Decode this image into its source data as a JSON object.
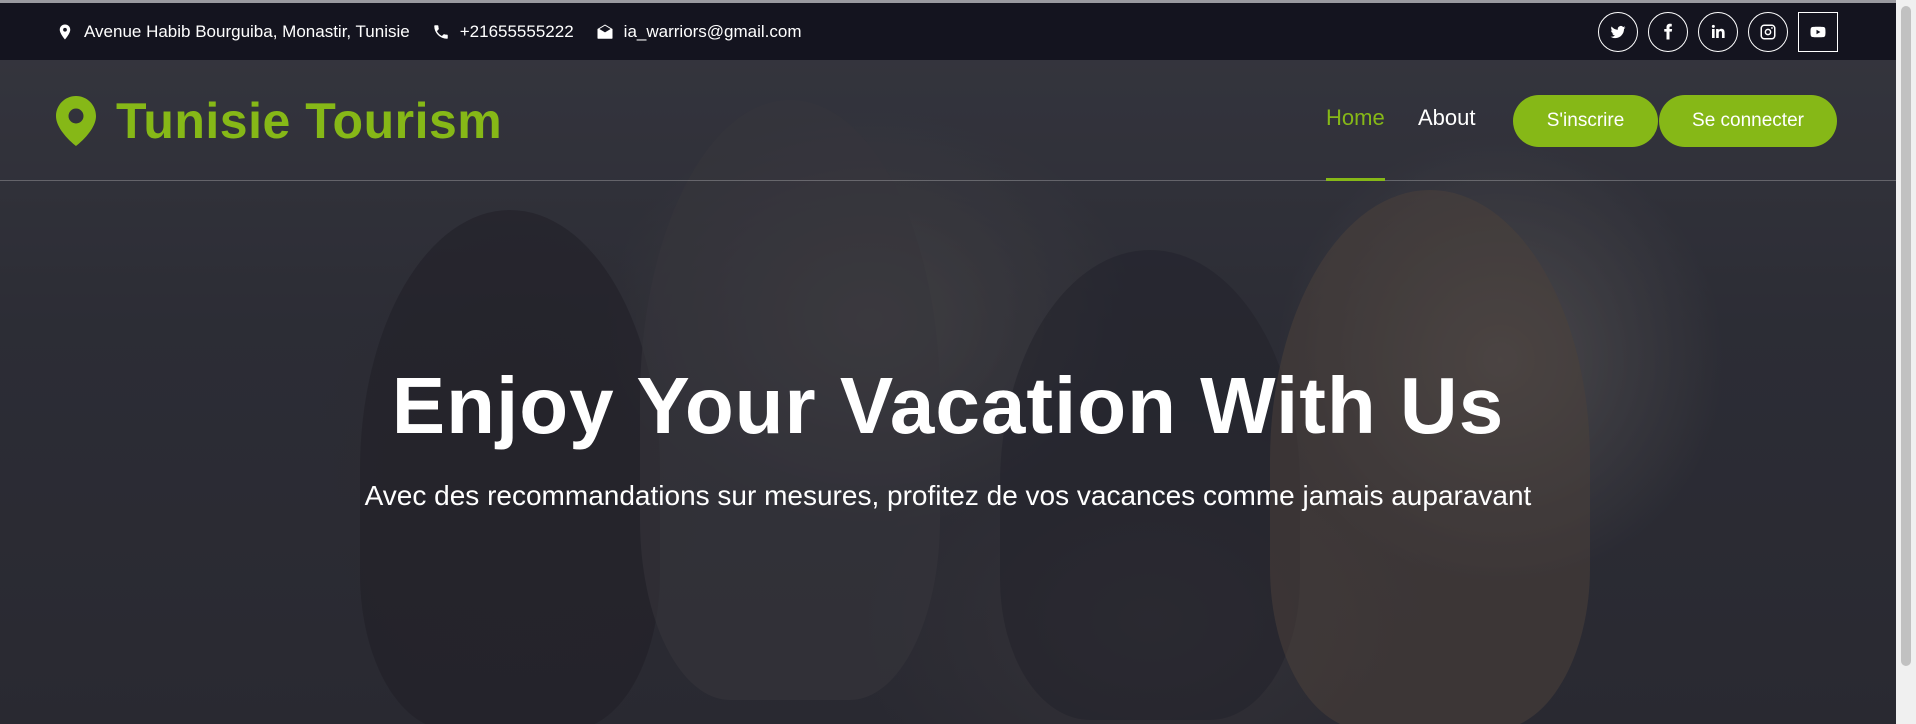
{
  "topbar": {
    "address": "Avenue Habib Bourguiba, Monastir, Tunisie",
    "phone": "+21655555222",
    "email": "ia_warriors@gmail.com",
    "socials": [
      "twitter-icon",
      "facebook-icon",
      "linkedin-icon",
      "instagram-icon",
      "youtube-icon"
    ]
  },
  "navbar": {
    "brand": "Tunisie Tourism",
    "links": [
      "Home",
      "About"
    ],
    "active_link": "Home",
    "signup_label": "S'inscrire",
    "login_label": "Se connecter"
  },
  "hero": {
    "title": "Enjoy Your Vacation With Us",
    "subtitle": "Avec des recommandations sur mesures, profitez de vos vacances comme jamais auparavant"
  },
  "colors": {
    "accent": "#86b817",
    "topbar_bg": "#14141f",
    "text_light": "#ffffff"
  }
}
